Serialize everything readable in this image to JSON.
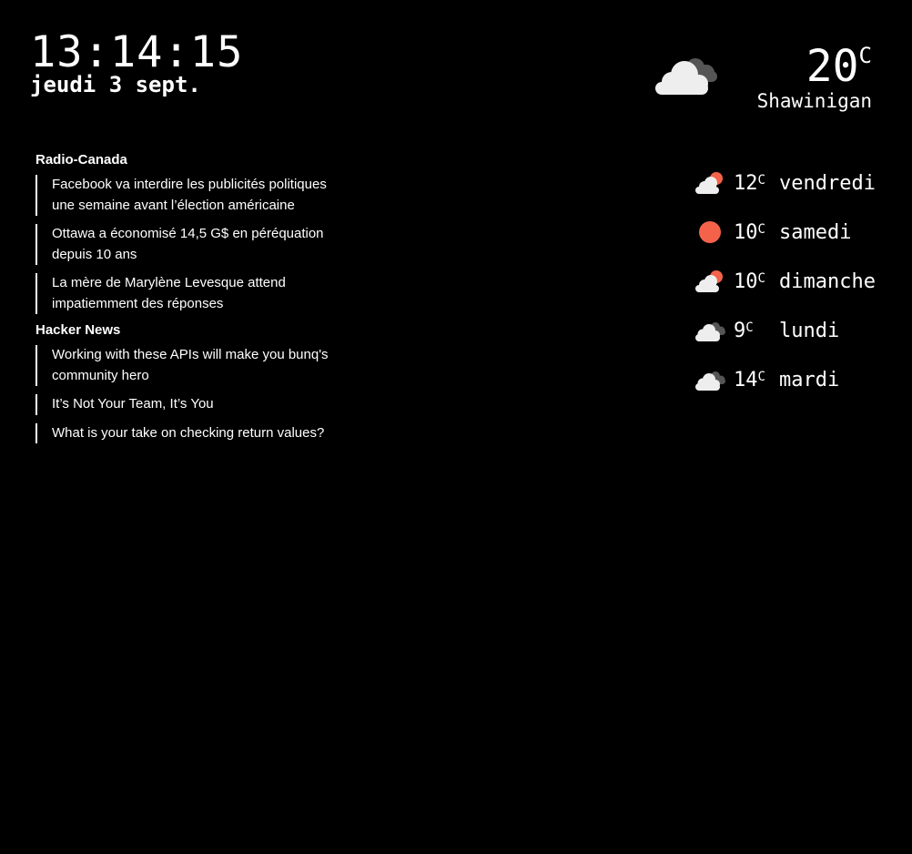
{
  "clock": {
    "time": "13:14:15",
    "date": "jeudi 3 sept."
  },
  "current_weather": {
    "icon": "cloudy-icon",
    "temperature": "20",
    "unit": "C",
    "city": "Shawinigan"
  },
  "news": [
    {
      "source": "Radio-Canada",
      "items": [
        "Facebook va interdire les publicités politiques une semaine avant l’élection américaine",
        "Ottawa a économisé 14,5 G$ en péréquation depuis 10 ans",
        "La mère de Marylène Levesque attend impatiemment des réponses"
      ]
    },
    {
      "source": "Hacker News",
      "items": [
        "Working with these APIs will make you bunq's community hero",
        "It’s Not Your Team, It’s You",
        "What is your take on checking return values?"
      ]
    }
  ],
  "forecast": [
    {
      "icon": "partly-cloudy-icon",
      "temperature": "12",
      "unit": "C",
      "day": "vendredi"
    },
    {
      "icon": "sun-icon",
      "temperature": "10",
      "unit": "C",
      "day": "samedi"
    },
    {
      "icon": "partly-cloudy-icon",
      "temperature": "10",
      "unit": "C",
      "day": "dimanche"
    },
    {
      "icon": "cloudy-icon",
      "temperature": "9",
      "unit": "C",
      "day": "lundi"
    },
    {
      "icon": "cloudy-icon",
      "temperature": "14",
      "unit": "C",
      "day": "mardi"
    }
  ],
  "colors": {
    "background": "#000000",
    "text": "#ffffff",
    "sun": "#f4624a",
    "cloud_light": "#eeeeee",
    "cloud_dark": "#555555"
  }
}
